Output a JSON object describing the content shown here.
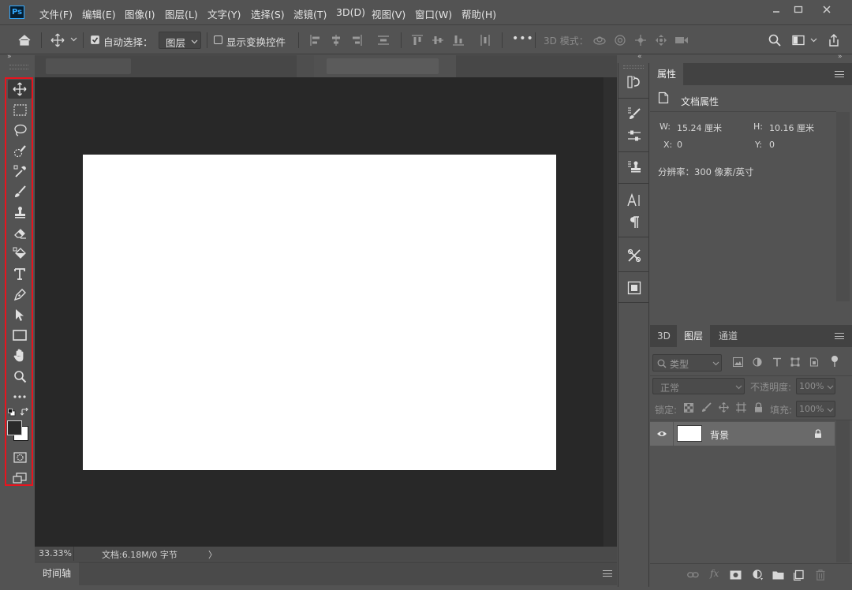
{
  "app": {
    "logo": "Ps",
    "menu": [
      "文件(F)",
      "编辑(E)",
      "图像(I)",
      "图层(L)",
      "文字(Y)",
      "选择(S)",
      "滤镜(T)",
      "3D(D)",
      "视图(V)",
      "窗口(W)",
      "帮助(H)"
    ],
    "window_controls": [
      "minimize-icon",
      "restore-icon",
      "close-icon"
    ]
  },
  "options_bar": {
    "auto_select_label": "自动选择：",
    "auto_select_checked": true,
    "auto_select_target": "图层",
    "show_transform_label": "显示变换控件",
    "show_transform_checked": false,
    "more_label": "•••",
    "mode_3d_label": "3D 模式："
  },
  "toolbar": {
    "tools": [
      "move-tool",
      "marquee-tool",
      "lasso-tool",
      "quick-select-tool",
      "eyedropper-tool",
      "brush-tool",
      "stamp-tool",
      "eraser-tool",
      "paint-bucket-tool",
      "type-tool",
      "pen-tool",
      "path-select-tool",
      "rectangle-tool",
      "hand-tool",
      "zoom-tool",
      "more-tools"
    ],
    "foreground_color": "#2b2b2b",
    "background_color": "#ffffff",
    "highlight_color": "#e8141e"
  },
  "document": {
    "zoom": "33.33%",
    "doc_info": "文档:6.18M/0 字节",
    "status_arrow": "〉"
  },
  "timeline": {
    "tab_label": "时间轴"
  },
  "properties": {
    "tab_label": "属性",
    "section_label": "文档属性",
    "w_label": "W:",
    "w_value": "15.24 厘米",
    "h_label": "H:",
    "h_value": "10.16 厘米",
    "x_label": "X:",
    "x_value": "0",
    "y_label": "Y:",
    "y_value": "0",
    "resolution": "分辨率：300 像素/英寸"
  },
  "layers": {
    "tabs": [
      "3D",
      "图层",
      "通道"
    ],
    "active_tab": "图层",
    "filter_label": "类型",
    "blend_mode": "正常",
    "opacity_label": "不透明度:",
    "opacity_value": "100%",
    "lock_label": "锁定:",
    "fill_label": "填充:",
    "fill_value": "100%",
    "items": [
      {
        "name": "背景",
        "visible": true,
        "locked": true
      }
    ]
  }
}
